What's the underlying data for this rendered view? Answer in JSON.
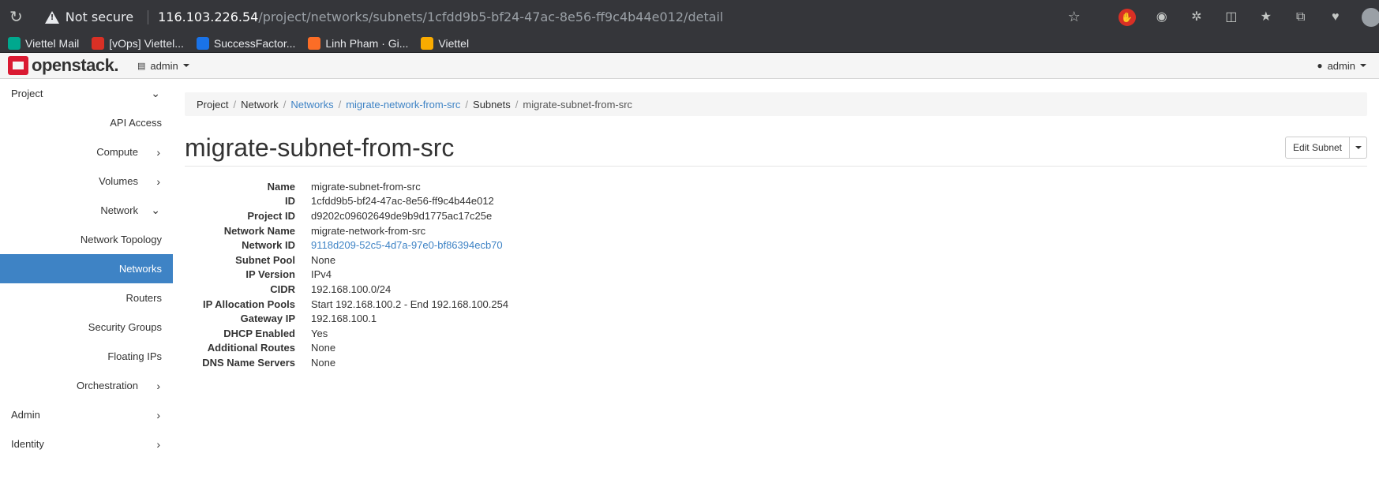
{
  "browser": {
    "security_label": "Not secure",
    "url_host": "116.103.226.54",
    "url_path": "/project/networks/subnets/1cfdd9b5-bf24-47ac-8e56-ff9c4b44e012/detail",
    "bookmarks": [
      {
        "label": "Viettel Mail",
        "color": "#00a88e"
      },
      {
        "label": "[vOps] Viettel...",
        "color": "#d93025"
      },
      {
        "label": "SuccessFactor...",
        "color": "#1a73e8"
      },
      {
        "label": "Linh Pham · Gi...",
        "color": "#fc6d26"
      },
      {
        "label": "Viettel",
        "color": "#f9ab00"
      }
    ]
  },
  "header": {
    "logo_text": "openstack.",
    "project_selector": "admin",
    "user_menu": "admin"
  },
  "sidebar": {
    "items": [
      {
        "label": "Project",
        "level": 0,
        "chevron": "down"
      },
      {
        "label": "API Access",
        "level": 2
      },
      {
        "label": "Compute",
        "level": 1,
        "chevron": "right"
      },
      {
        "label": "Volumes",
        "level": 1,
        "chevron": "right"
      },
      {
        "label": "Network",
        "level": 1,
        "chevron": "down"
      },
      {
        "label": "Network Topology",
        "level": 2
      },
      {
        "label": "Networks",
        "level": 2,
        "active": true
      },
      {
        "label": "Routers",
        "level": 2
      },
      {
        "label": "Security Groups",
        "level": 2
      },
      {
        "label": "Floating IPs",
        "level": 2
      },
      {
        "label": "Orchestration",
        "level": 1,
        "chevron": "right"
      },
      {
        "label": "Admin",
        "level": 0,
        "chevron": "right"
      },
      {
        "label": "Identity",
        "level": 0,
        "chevron": "right"
      }
    ]
  },
  "breadcrumb": {
    "project": "Project",
    "network": "Network",
    "networks": "Networks",
    "network_name": "migrate-network-from-src",
    "subnets": "Subnets",
    "subnet_name": "migrate-subnet-from-src"
  },
  "page": {
    "title": "migrate-subnet-from-src",
    "edit_button": "Edit Subnet"
  },
  "details": [
    {
      "label": "Name",
      "value": "migrate-subnet-from-src"
    },
    {
      "label": "ID",
      "value": "1cfdd9b5-bf24-47ac-8e56-ff9c4b44e012"
    },
    {
      "label": "Project ID",
      "value": "d9202c09602649de9b9d1775ac17c25e"
    },
    {
      "label": "Network Name",
      "value": "migrate-network-from-src"
    },
    {
      "label": "Network ID",
      "value": "9118d209-52c5-4d7a-97e0-bf86394ecb70",
      "link": true
    },
    {
      "label": "Subnet Pool",
      "value": "None"
    },
    {
      "label": "IP Version",
      "value": "IPv4"
    },
    {
      "label": "CIDR",
      "value": "192.168.100.0/24"
    },
    {
      "label": "IP Allocation Pools",
      "value": "Start 192.168.100.2 - End 192.168.100.254"
    },
    {
      "label": "Gateway IP",
      "value": "192.168.100.1"
    },
    {
      "label": "DHCP Enabled",
      "value": "Yes"
    },
    {
      "label": "Additional Routes",
      "value": "None"
    },
    {
      "label": "DNS Name Servers",
      "value": "None"
    }
  ]
}
